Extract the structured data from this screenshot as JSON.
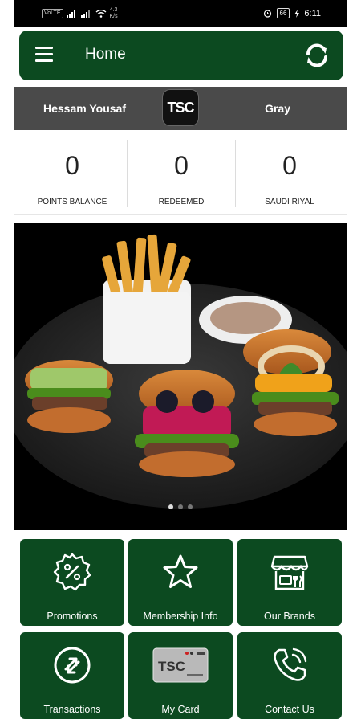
{
  "status_bar": {
    "network_tag": "VoLTE",
    "speed_value": "4.3",
    "speed_unit": "K/s",
    "battery": "66",
    "time": "6:11"
  },
  "app_bar": {
    "title": "Home"
  },
  "user": {
    "name": "Hessam Yousaf",
    "logo_text": "TSC",
    "tier": "Gray"
  },
  "stats": [
    {
      "value": "0",
      "label": "POINTS BALANCE"
    },
    {
      "value": "0",
      "label": "REDEEMED"
    },
    {
      "value": "0",
      "label": "SAUDI RIYAL"
    }
  ],
  "banner": {
    "slide_count": 3,
    "active_index": 0
  },
  "tiles": [
    {
      "label": "Promotions",
      "icon": "discount-badge-icon"
    },
    {
      "label": "Membership Info",
      "icon": "star-icon"
    },
    {
      "label": "Our Brands",
      "icon": "store-icon"
    },
    {
      "label": "Transactions",
      "icon": "exchange-arrows-icon"
    },
    {
      "label": "My Card",
      "icon": "card-image",
      "card_text": "TSC"
    },
    {
      "label": "Contact Us",
      "icon": "phone-ringing-icon"
    }
  ],
  "colors": {
    "primary_green": "#0c4a20",
    "user_bar_gray": "#4a4a4a"
  }
}
